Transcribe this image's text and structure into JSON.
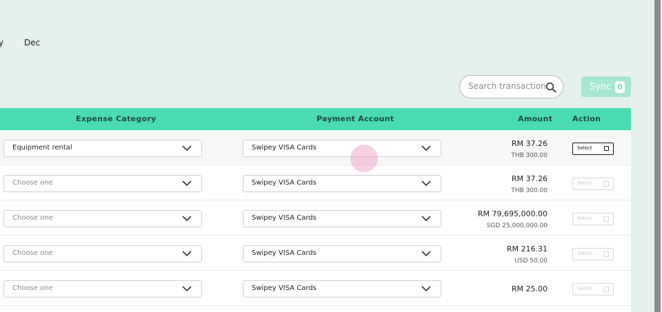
{
  "months": {
    "partial": "y",
    "current": "Dec"
  },
  "search": {
    "placeholder": "Search transaction"
  },
  "sync": {
    "label": "Sync",
    "count": "0"
  },
  "table": {
    "headers": {
      "expense_category": "Expense Category",
      "payment_account": "Payment Account",
      "amount": "Amount",
      "action": "Action"
    },
    "action_select_label": "Select",
    "rows": [
      {
        "expense": "Equipment rental",
        "expense_placeholder": false,
        "payment": "Swipey VISA Cards",
        "amount": "RM 37.26",
        "original": "THB 300.00"
      },
      {
        "expense": "Choose one",
        "expense_placeholder": true,
        "payment": "Swipey VISA Cards",
        "amount": "RM 37.26",
        "original": "THB 300.00"
      },
      {
        "expense": "Choose one",
        "expense_placeholder": true,
        "payment": "Swipey VISA Cards",
        "amount": "RM 79,695,000.00",
        "original": "SGD 25,000,000.00"
      },
      {
        "expense": "Choose one",
        "expense_placeholder": true,
        "payment": "Swipey VISA Cards",
        "amount": "RM 216.31",
        "original": "USD 50.00"
      },
      {
        "expense": "Choose one",
        "expense_placeholder": true,
        "payment": "Swipey VISA Cards",
        "amount": "RM 25.00",
        "original": ""
      }
    ]
  },
  "colors": {
    "accent": "#4bdbb2",
    "background": "#e4f1ed",
    "sync_button": "#a8e6d4"
  },
  "icons": {
    "search": "search-icon",
    "dropdown": "chevron-down-icon",
    "checkbox": "checkbox-icon"
  }
}
